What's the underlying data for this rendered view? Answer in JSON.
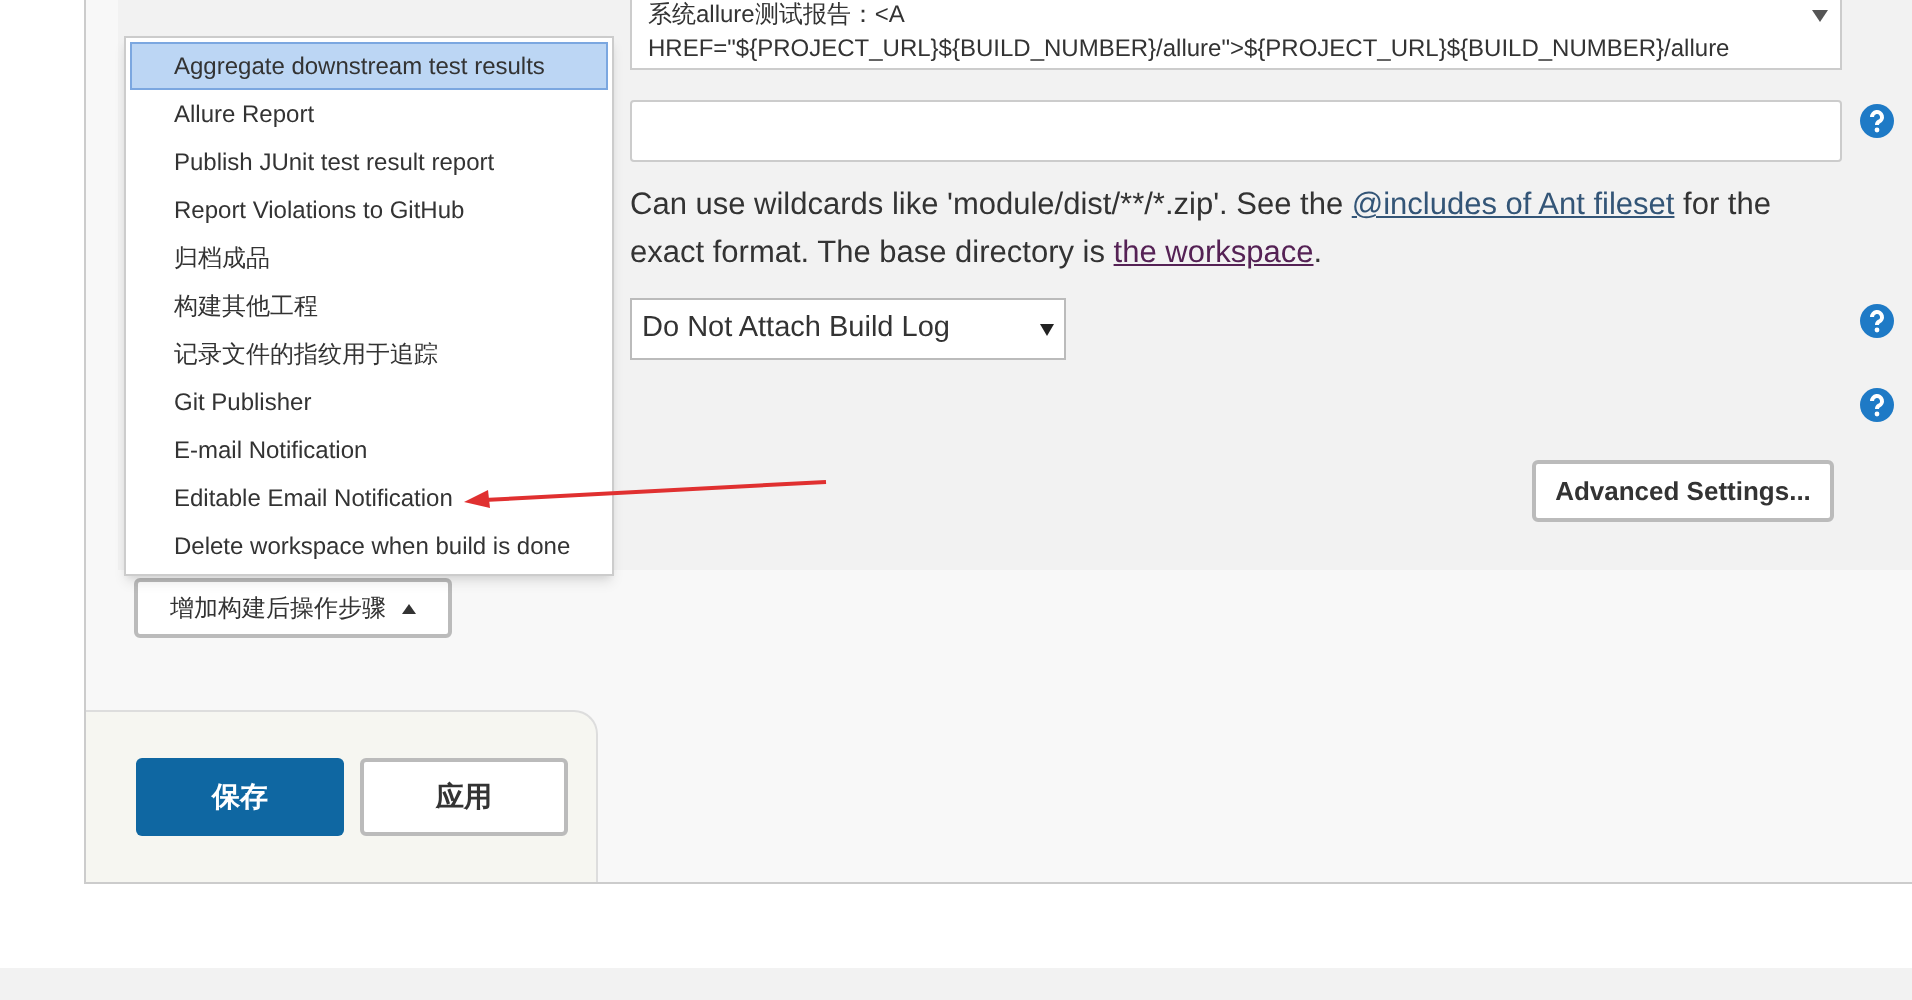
{
  "textarea": {
    "lines": [
      "系统allure测试报告：<A",
      "HREF=\"${PROJECT_URL}${BUILD_NUMBER}/allure\">${PROJECT_URL}${BUILD_NUMBER}/allure"
    ]
  },
  "help_text": {
    "before": "Can use wildcards like 'module/dist/**/*.zip'. See the ",
    "link1": "@includes of Ant fileset",
    "middle": " for the exact format. The base directory is ",
    "link2": "the workspace",
    "after": "."
  },
  "attach_log_select": {
    "value": "Do Not Attach Build Log"
  },
  "advanced_button": "Advanced Settings...",
  "menu": {
    "items": [
      {
        "label": "Aggregate downstream test results",
        "selected": true
      },
      {
        "label": "Allure Report",
        "selected": false
      },
      {
        "label": "Publish JUnit test result report",
        "selected": false
      },
      {
        "label": "Report Violations to GitHub",
        "selected": false
      },
      {
        "label": "归档成品",
        "selected": false
      },
      {
        "label": "构建其他工程",
        "selected": false
      },
      {
        "label": "记录文件的指纹用于追踪",
        "selected": false
      },
      {
        "label": "Git Publisher",
        "selected": false
      },
      {
        "label": "E-mail Notification",
        "selected": false
      },
      {
        "label": "Editable Email Notification",
        "selected": false
      },
      {
        "label": "Delete workspace when build is done",
        "selected": false
      }
    ]
  },
  "add_step_button": "增加构建后操作步骤",
  "save_button": "保存",
  "apply_button": "应用"
}
